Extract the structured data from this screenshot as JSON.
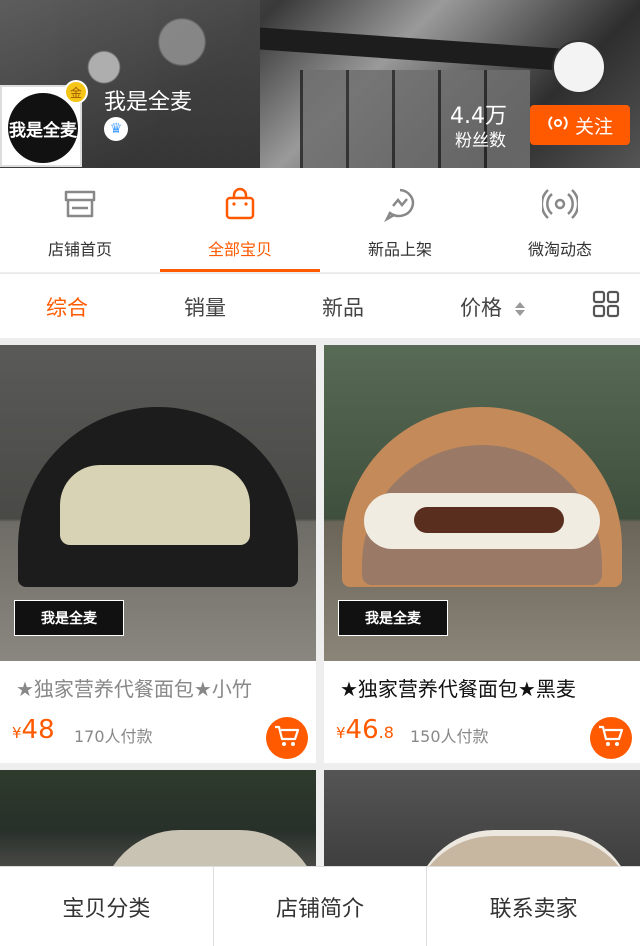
{
  "header": {
    "shop_name": "我是全麦",
    "logo_text": "我是全麦",
    "gold_badge": "金",
    "fans_count": "4.4万",
    "fans_label": "粉丝数",
    "follow_label": "关注"
  },
  "shop_nav": [
    {
      "label": "店铺首页",
      "icon": "store-icon",
      "active": false
    },
    {
      "label": "全部宝贝",
      "icon": "shopping-bag-icon",
      "active": true
    },
    {
      "label": "新品上架",
      "icon": "new-arrivals-icon",
      "active": false
    },
    {
      "label": "微淘动态",
      "icon": "broadcast-icon",
      "active": false
    }
  ],
  "sort_bar": {
    "tabs": [
      "综合",
      "销量",
      "新品",
      "价格"
    ],
    "active": "综合"
  },
  "products": [
    {
      "title": "★独家营养代餐面包★小竹",
      "currency": "¥",
      "price_int": "48",
      "price_dec": "",
      "sold": "170人付款",
      "stamp": "我是全麦"
    },
    {
      "title": "★独家营养代餐面包★黑麦",
      "currency": "¥",
      "price_int": "46",
      "price_dec": ".8",
      "sold": "150人付款",
      "stamp": "我是全麦"
    }
  ],
  "bottom_bar": [
    "宝贝分类",
    "店铺简介",
    "联系卖家"
  ],
  "colors": {
    "accent": "#ff5a00"
  }
}
